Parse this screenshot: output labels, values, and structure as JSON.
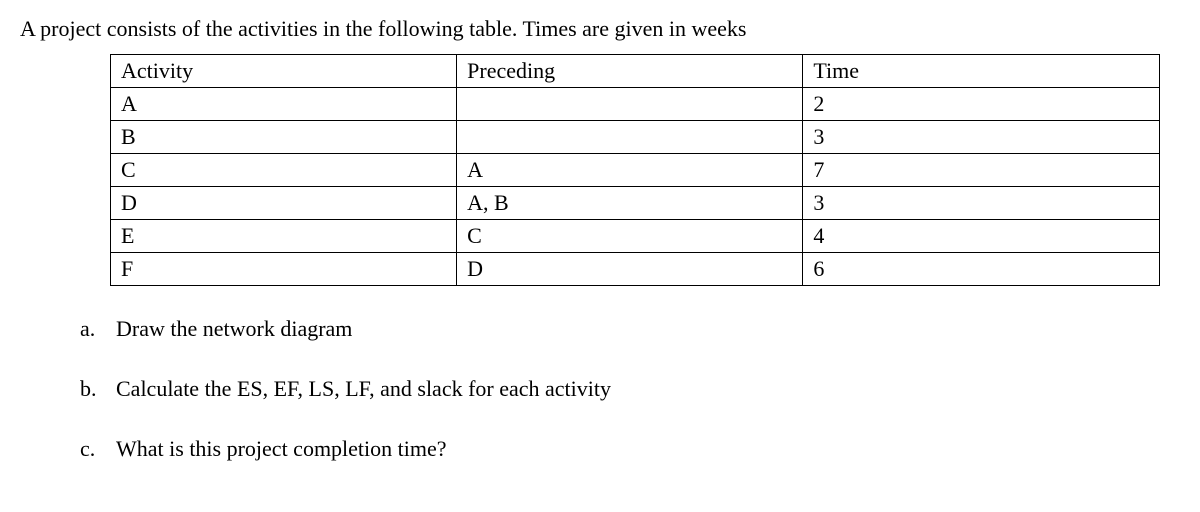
{
  "intro": "A project consists of the activities in the following table. Times are given in weeks",
  "table": {
    "headers": {
      "activity": "Activity",
      "preceding": "Preceding",
      "time": "Time"
    },
    "rows": [
      {
        "activity": "A",
        "preceding": "",
        "time": "2"
      },
      {
        "activity": "B",
        "preceding": "",
        "time": "3"
      },
      {
        "activity": "C",
        "preceding": "A",
        "time": "7"
      },
      {
        "activity": "D",
        "preceding": "A, B",
        "time": "3"
      },
      {
        "activity": "E",
        "preceding": "C",
        "time": "4"
      },
      {
        "activity": "F",
        "preceding": "D",
        "time": "6"
      }
    ]
  },
  "questions": [
    {
      "marker": "a.",
      "text": "Draw the network diagram"
    },
    {
      "marker": "b.",
      "text": "Calculate the ES, EF, LS, LF, and slack for each activity"
    },
    {
      "marker": "c.",
      "text": "What is this project completion time?"
    }
  ]
}
